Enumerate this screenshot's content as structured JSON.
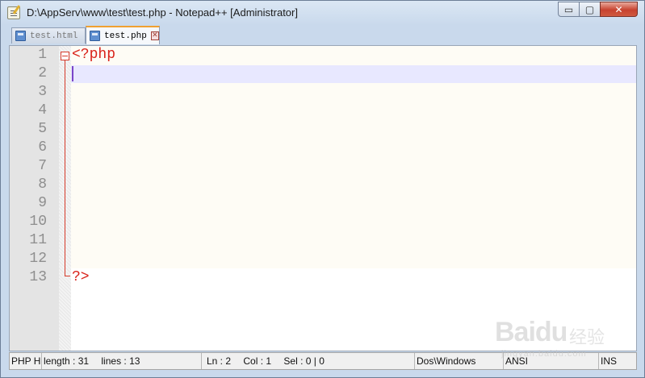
{
  "window": {
    "title": "D:\\AppServ\\www\\test\\test.php - Notepad++ [Administrator]",
    "controls": {
      "minimize": "▭",
      "maximize": "▢",
      "close": "✕"
    }
  },
  "tabs": [
    {
      "label": "test.html",
      "active": false,
      "icon": "file-saved-icon"
    },
    {
      "label": "test.php",
      "active": true,
      "icon": "file-saved-icon"
    }
  ],
  "editor": {
    "line_numbers": [
      "1",
      "2",
      "3",
      "4",
      "5",
      "6",
      "7",
      "8",
      "9",
      "10",
      "11",
      "12",
      "13"
    ],
    "lines": [
      "<?php",
      "",
      "",
      "",
      "",
      "",
      "",
      "",
      "",
      "",
      "",
      "",
      "?>"
    ],
    "current_line": 2,
    "colors": {
      "php_tag": "#d9231b",
      "caret_line": "#e8e8ff",
      "php_background": "#fefcf5",
      "fold_marker": "#d53a2a"
    }
  },
  "statusbar": {
    "language": "PHP H",
    "length": "length : 31",
    "lines": "lines : 13",
    "ln": "Ln : 2",
    "col": "Col : 1",
    "sel": "Sel : 0 | 0",
    "eol": "Dos\\Windows",
    "encoding": "ANSI",
    "mode": "INS"
  },
  "watermark": {
    "brand": "Baidu",
    "cn": "经验",
    "sub": "jingyan.baidu.com"
  }
}
